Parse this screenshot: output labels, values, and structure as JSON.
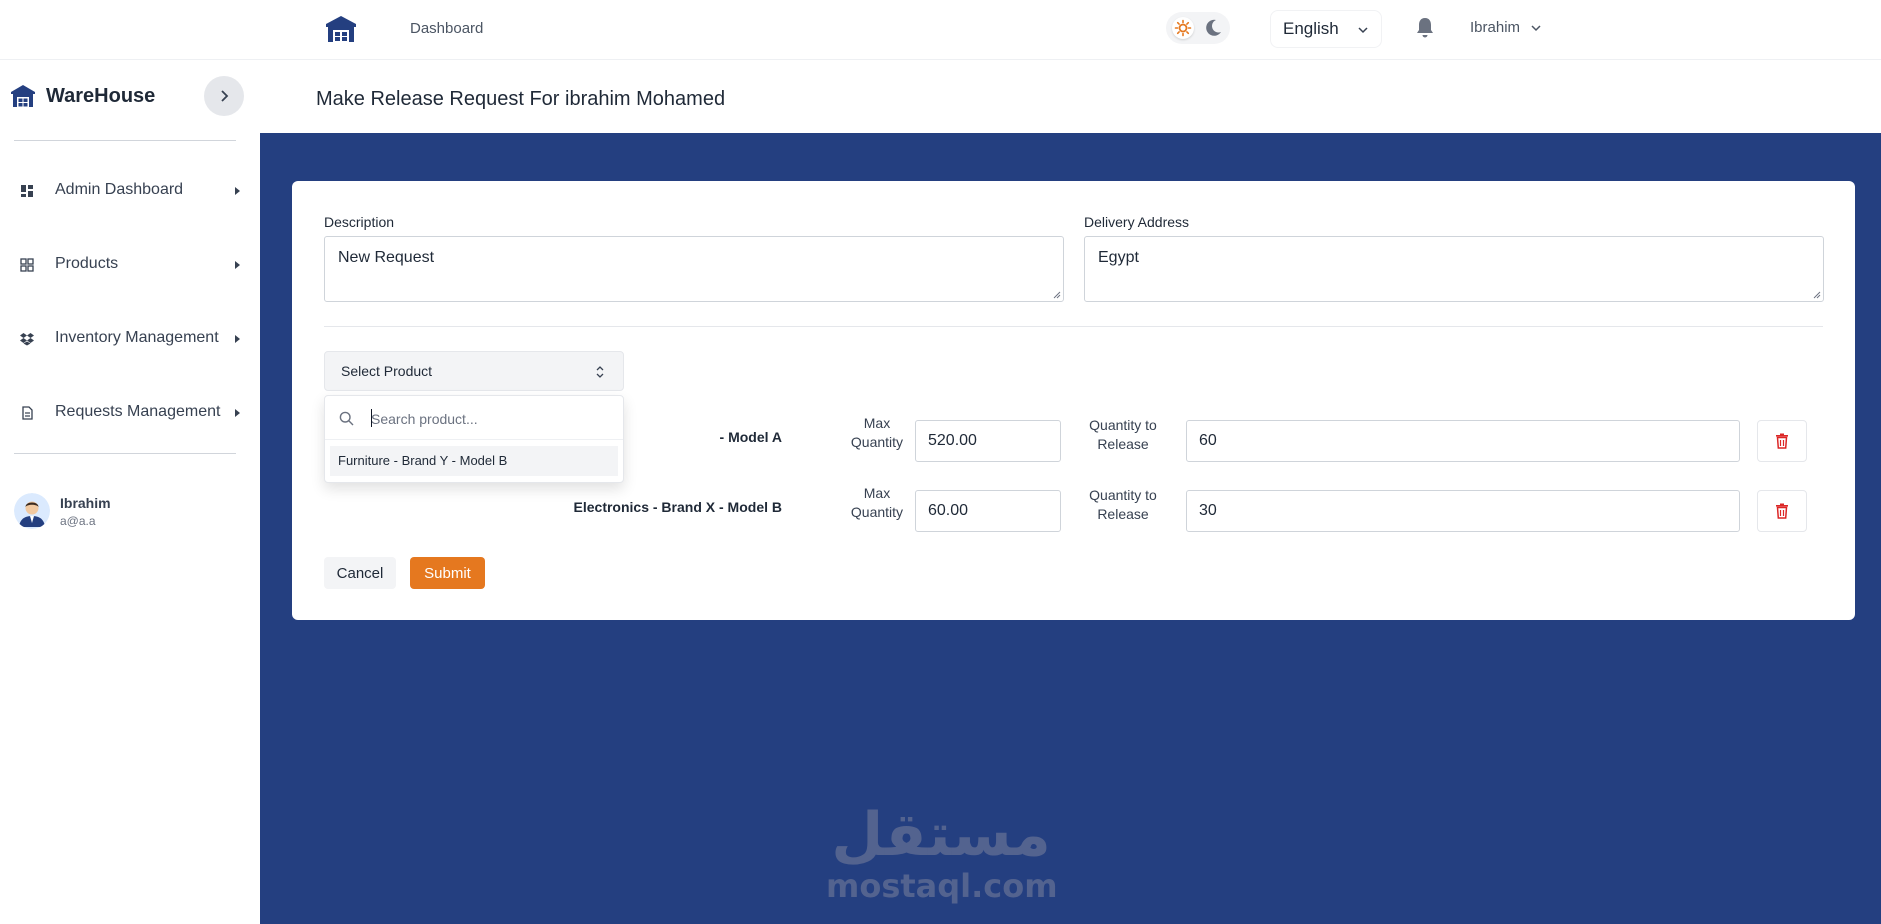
{
  "topbar": {
    "home_icon": "warehouse-icon",
    "breadcrumb": "Dashboard",
    "theme": {
      "sun_icon": "sun-icon",
      "moon_icon": "moon-icon"
    },
    "language": "English",
    "notifications_icon": "bell-icon",
    "user_name": "Ibrahim"
  },
  "sidebar": {
    "brand": "WareHouse",
    "items": [
      {
        "label": "Admin Dashboard",
        "icon": "dashboard-icon"
      },
      {
        "label": "Products",
        "icon": "grid-icon"
      },
      {
        "label": "Inventory Management",
        "icon": "dropbox-icon"
      },
      {
        "label": "Requests Management",
        "icon": "document-icon"
      }
    ],
    "profile": {
      "name": "Ibrahim",
      "email": "a@a.a"
    }
  },
  "page": {
    "title": "Make Release Request For ibrahim Mohamed"
  },
  "form": {
    "description_label": "Description",
    "description_value": "New Request",
    "address_label": "Delivery Address",
    "address_value": "Egypt",
    "select_product_label": "Select Product",
    "search_placeholder": "Search product...",
    "dropdown_options": [
      "Furniture - Brand Y - Model B"
    ],
    "rows": [
      {
        "product": "- Model A",
        "max_label": "Max Quantity",
        "max_value": "520.00",
        "qty_label": "Quantity to Release",
        "qty_value": "60"
      },
      {
        "product": "Electronics - Brand X - Model B",
        "max_label": "Max Quantity",
        "max_value": "60.00",
        "qty_label": "Quantity to Release",
        "qty_value": "30"
      }
    ],
    "cancel_label": "Cancel",
    "submit_label": "Submit"
  },
  "colors": {
    "main_bg": "#243f80",
    "submit": "#e5781f",
    "delete": "#dc2626"
  },
  "watermark": {
    "arabic": "مستقل",
    "latin": "mostaql.com"
  }
}
